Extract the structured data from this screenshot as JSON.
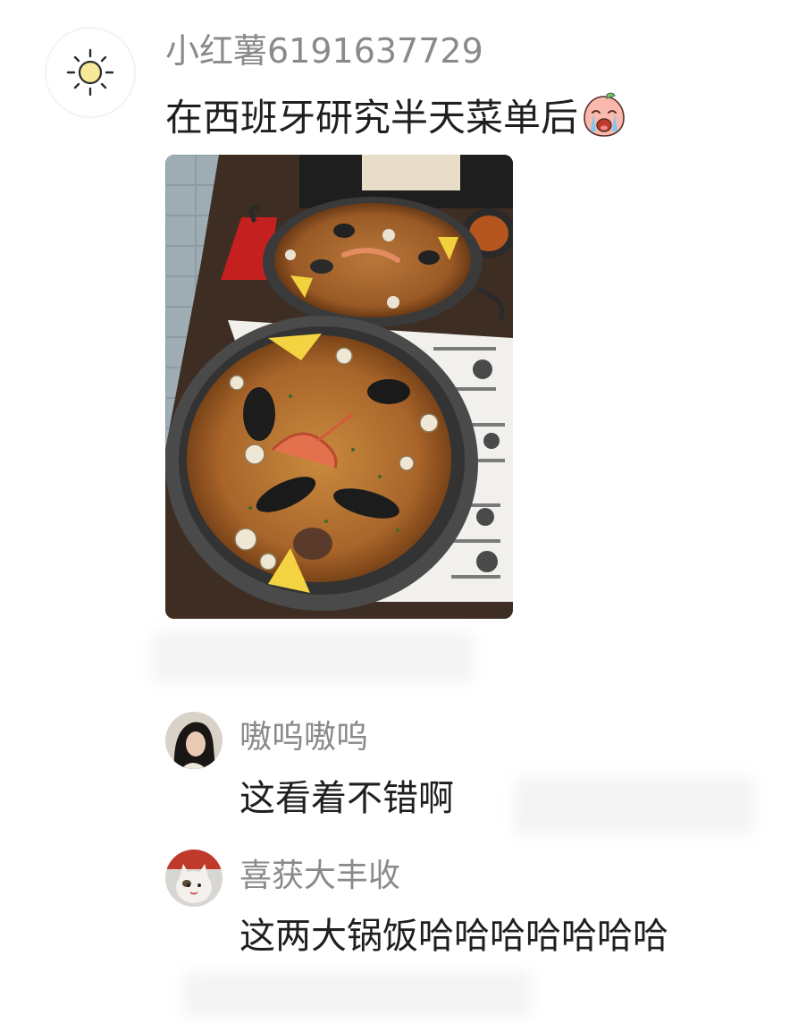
{
  "post": {
    "avatar_icon": "sun-icon",
    "username": "小红薯6191637729",
    "text": "在西班牙研究半天菜单后",
    "emoji_icon": "crying-face-emoji-icon",
    "image_icon": "paella-photo"
  },
  "comments": [
    {
      "avatar_icon": "user-photo-avatar",
      "username": "嗷呜嗷呜",
      "text": "这看着不错啊"
    },
    {
      "avatar_icon": "cat-photo-avatar",
      "username": "喜获大丰收",
      "text": "这两大锅饭哈哈哈哈哈哈哈"
    }
  ]
}
